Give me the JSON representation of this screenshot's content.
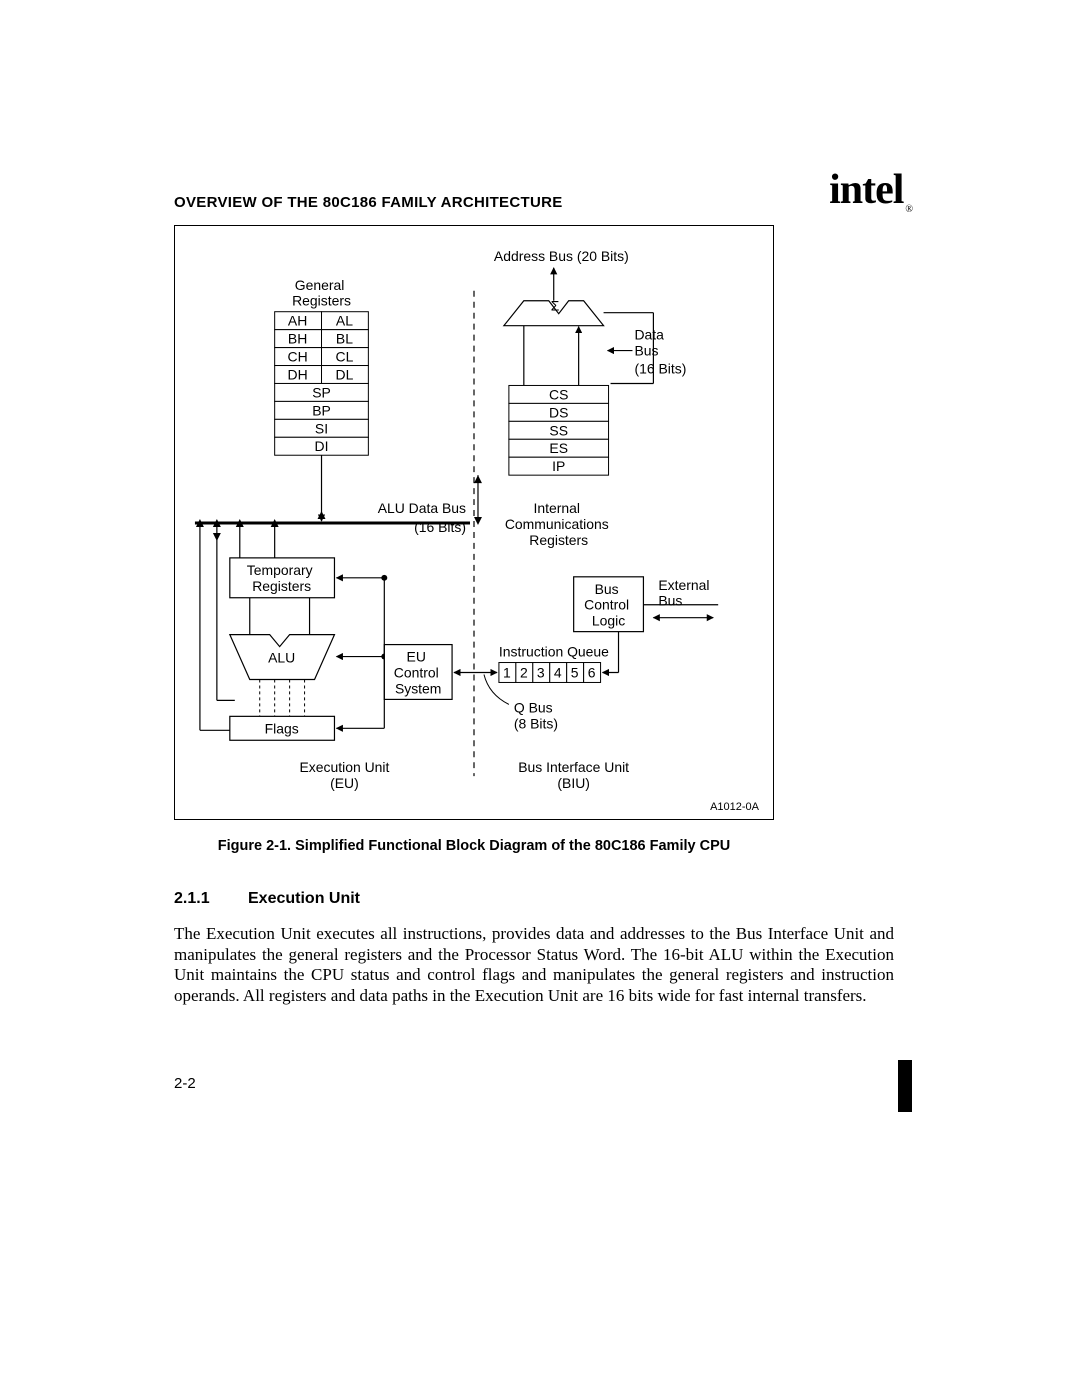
{
  "header": {
    "title": "OVERVIEW OF THE 80C186 FAMILY ARCHITECTURE",
    "logo_text": "intel",
    "logo_reg": "®"
  },
  "figure": {
    "address_bus": "Address Bus (20 Bits)",
    "general_registers_title": "General\nRegisters",
    "gp_regs_8": [
      "AH",
      "AL",
      "BH",
      "BL",
      "CH",
      "CL",
      "DH",
      "DL"
    ],
    "gp_regs_16": [
      "SP",
      "BP",
      "SI",
      "DI"
    ],
    "sigma": "Σ",
    "data_bus": "Data\nBus",
    "data_bus_bits": "(16 Bits)",
    "seg_regs": [
      "CS",
      "DS",
      "SS",
      "ES",
      "IP"
    ],
    "alu_data_bus": "ALU Data Bus",
    "alu_data_bus_bits": "(16 Bits)",
    "internal_comm": "Internal\nCommunications\nRegisters",
    "temporary_registers": "Temporary\nRegisters",
    "bus_control_logic": "Bus\nControl\nLogic",
    "external_bus": "External\nBus",
    "alu": "ALU",
    "eu_control": "EU\nControl\nSystem",
    "instruction_queue": "Instruction Queue",
    "queue_cells": [
      "1",
      "2",
      "3",
      "4",
      "5",
      "6"
    ],
    "q_bus": "Q  Bus",
    "q_bus_bits": "(8 Bits)",
    "flags": "Flags",
    "eu_label": "Execution Unit",
    "eu_abbrev": "(EU)",
    "biu_label": "Bus Interface Unit",
    "biu_abbrev": "(BIU)",
    "figure_code": "A1012-0A"
  },
  "caption": "Figure 2-1.  Simplified Functional Block Diagram of the 80C186 Family CPU",
  "section": {
    "number": "2.1.1",
    "title": "Execution Unit"
  },
  "body": "The Execution Unit executes all instructions, provides data and addresses to the Bus Interface Unit and manipulates the general registers and the Processor Status Word. The 16-bit ALU within the Execution Unit maintains the CPU status and control flags and manipulates the general registers and instruction operands. All registers and data paths in the Execution Unit are 16 bits wide for fast internal transfers.",
  "page_number": "2-2"
}
